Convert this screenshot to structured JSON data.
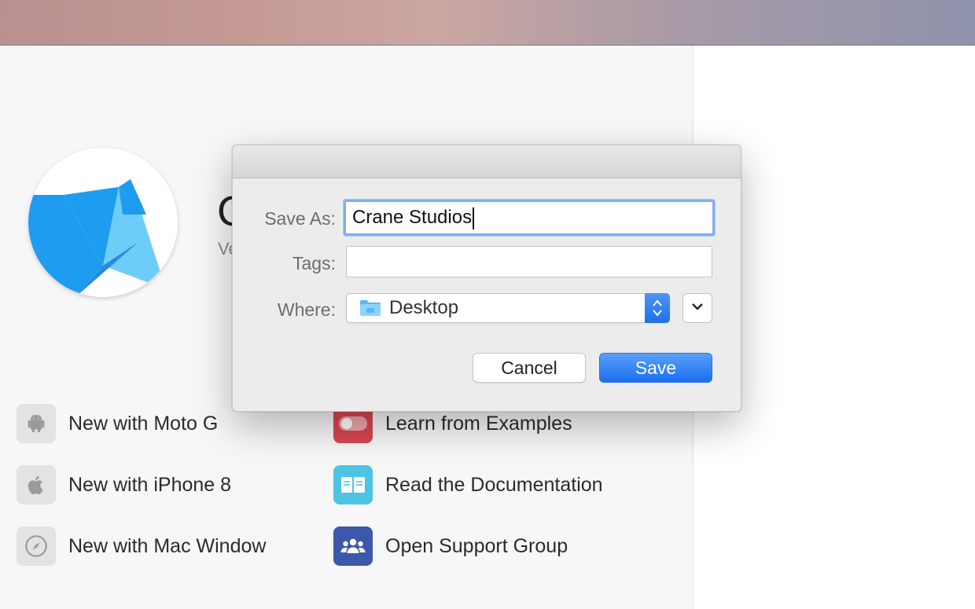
{
  "welcome": {
    "title": "C",
    "version": "Ve",
    "actions": [
      {
        "label": "New with Moto G",
        "icon": "android-icon"
      },
      {
        "label": "New with iPhone 8",
        "icon": "apple-icon"
      },
      {
        "label": "New with Mac Window",
        "icon": "compass-icon"
      },
      {
        "label": "Learn from Examples",
        "icon": "toggle-icon"
      },
      {
        "label": "Read the Documentation",
        "icon": "book-icon"
      },
      {
        "label": "Open Support Group",
        "icon": "group-icon"
      }
    ]
  },
  "dialog": {
    "save_as_label": "Save As:",
    "save_as_value": "Crane Studios",
    "tags_label": "Tags:",
    "tags_value": "",
    "where_label": "Where:",
    "where_value": "Desktop",
    "cancel_label": "Cancel",
    "save_label": "Save"
  },
  "colors": {
    "accent": "#1f6fe8",
    "logo_blue": "#1e9cf0",
    "logo_light": "#6dcdf8"
  }
}
